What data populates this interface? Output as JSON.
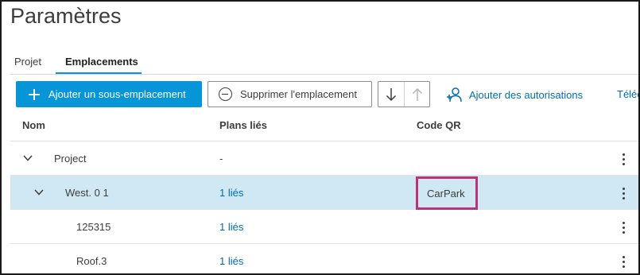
{
  "page": {
    "title": "Paramètres"
  },
  "tabs": [
    {
      "label": "Projet",
      "active": false
    },
    {
      "label": "Emplacements",
      "active": true
    }
  ],
  "toolbar": {
    "add_sub_location": "Ajouter un sous-emplacement",
    "delete_location": "Supprimer l'emplacement",
    "move_down_icon": "arrow-down-icon",
    "move_up_icon": "arrow-up-icon",
    "add_permissions": "Ajouter des autorisations",
    "download_partial": "Téléc"
  },
  "table": {
    "headers": {
      "name": "Nom",
      "linked_plans": "Plans liés",
      "qr_code": "Code QR"
    },
    "rows": [
      {
        "name": "Project",
        "plans": "-",
        "qr": "",
        "level": 0,
        "expandable": true,
        "selected": false
      },
      {
        "name": "West. 0 1",
        "plans": "1 liés",
        "qr": "CarPark",
        "level": 1,
        "expandable": true,
        "selected": true
      },
      {
        "name": "125315",
        "plans": "1 liés",
        "qr": "",
        "level": 2,
        "expandable": false,
        "selected": false
      },
      {
        "name": "Roof.3",
        "plans": "1 liés",
        "qr": "",
        "level": 2,
        "expandable": false,
        "selected": false
      }
    ]
  },
  "colors": {
    "accent": "#0696d7",
    "link": "#006eaf",
    "selected_row": "#cfe8f3",
    "highlight_box": "#bf2f7a"
  }
}
